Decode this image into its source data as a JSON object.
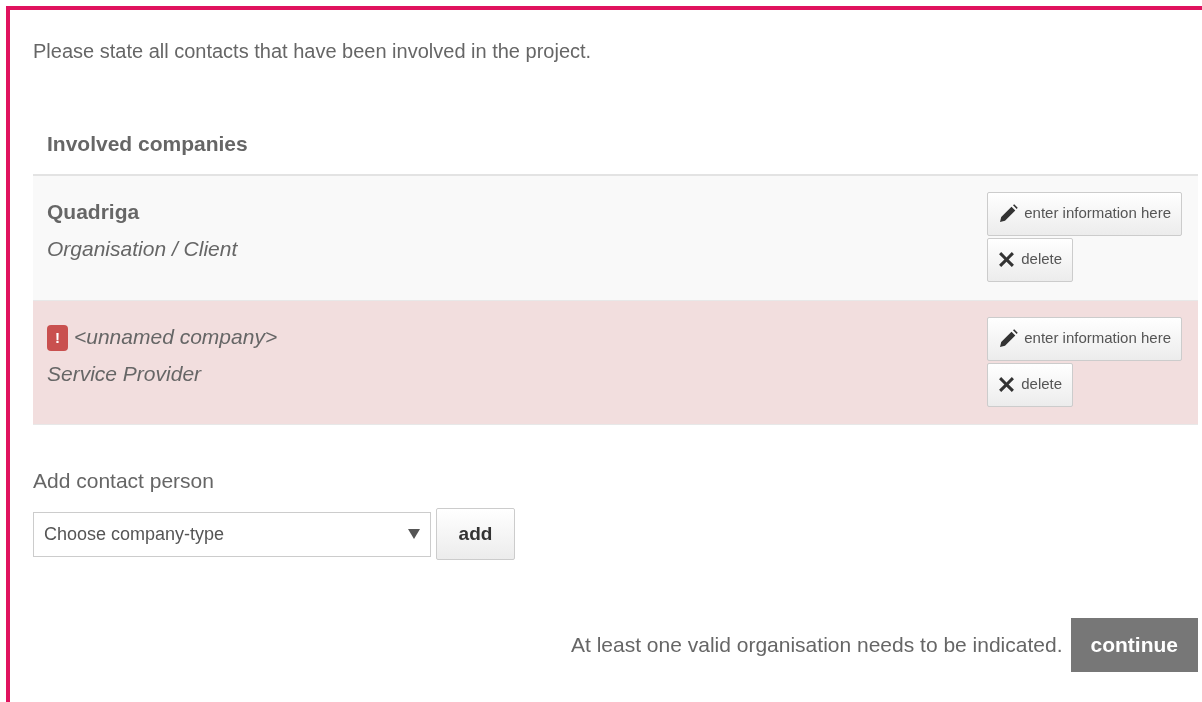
{
  "intro": "Please state all contacts that have been involved in the project.",
  "companies_table": {
    "heading": "Involved companies",
    "rows": [
      {
        "name": "Quadriga",
        "role": "Organisation / Client",
        "valid": true,
        "edit_button": "enter information here",
        "delete_button": "delete"
      },
      {
        "name": "<unnamed company>",
        "role": "Service Provider",
        "valid": false,
        "error_icon": "!",
        "edit_button": "enter information here",
        "delete_button": "delete"
      }
    ]
  },
  "add_contact": {
    "label": "Add contact person",
    "select_value": "Choose company-type",
    "add_button": "add"
  },
  "footer": {
    "message": "At least one valid organisation needs to be indicated.",
    "continue_button": "continue",
    "continue_disabled": true
  }
}
